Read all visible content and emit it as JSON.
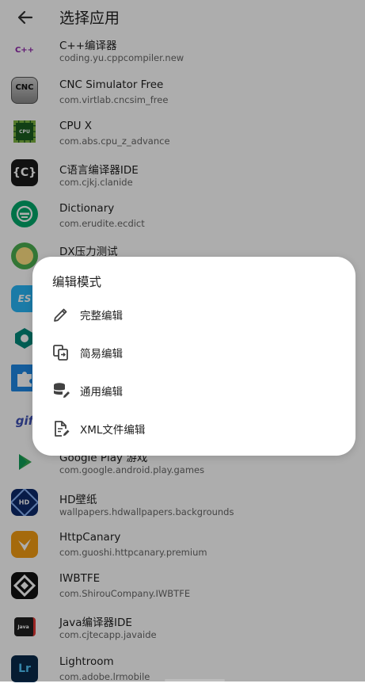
{
  "header": {
    "title": "选择应用"
  },
  "apps": [
    {
      "name": "C++编译器",
      "package": "coding.yu.cppcompiler.new",
      "icon": "cpp-compiler-icon"
    },
    {
      "name": "CNC Simulator Free",
      "package": "com.virtlab.cncsim_free",
      "icon": "cnc-icon"
    },
    {
      "name": "CPU X",
      "package": "com.abs.cpu_z_advance",
      "icon": "cpu-icon"
    },
    {
      "name": "C语言编译器IDE",
      "package": "com.cjkj.clanide",
      "icon": "c-ide-icon"
    },
    {
      "name": "Dictionary",
      "package": "com.erudite.ecdict",
      "icon": "dictionary-icon"
    },
    {
      "name": "DX压力测试",
      "package": "",
      "icon": "dx-test-icon"
    },
    {
      "name": "",
      "package": "",
      "icon": "es-icon"
    },
    {
      "name": "",
      "package": "",
      "icon": "hex-icon"
    },
    {
      "name": "",
      "package": "",
      "icon": "puzzle-icon"
    },
    {
      "name": "",
      "package": "",
      "icon": "gif-icon"
    },
    {
      "name": "Google Play 游戏",
      "package": "com.google.android.play.games",
      "icon": "play-games-icon"
    },
    {
      "name": "HD壁纸",
      "package": "wallpapers.hdwallpapers.backgrounds",
      "icon": "hd-wallpaper-icon"
    },
    {
      "name": "HttpCanary",
      "package": "com.guoshi.httpcanary.premium",
      "icon": "httpcanary-icon"
    },
    {
      "name": "IWBTFE",
      "package": "com.ShirouCompany.IWBTFE",
      "icon": "iwbtfe-icon"
    },
    {
      "name": "Java编译器IDE",
      "package": "com.cjtecapp.javaide",
      "icon": "java-ide-icon"
    },
    {
      "name": "Lightroom",
      "package": "com.adobe.lrmobile",
      "icon": "lightroom-icon"
    }
  ],
  "dialog": {
    "title": "编辑模式",
    "options": [
      {
        "label": "完整编辑",
        "icon": "pencil-icon"
      },
      {
        "label": "简易编辑",
        "icon": "copy-edit-icon"
      },
      {
        "label": "通用编辑",
        "icon": "database-edit-icon"
      },
      {
        "label": "XML文件编辑",
        "icon": "file-edit-icon"
      }
    ]
  },
  "icon_labels": {
    "cpp": "C++",
    "cnc": "CNC",
    "cpu": "CPU",
    "c_ide": "{C}",
    "es": "ES",
    "gif": "gif",
    "hd": "HD",
    "java": "Java",
    "lr": "Lr"
  }
}
